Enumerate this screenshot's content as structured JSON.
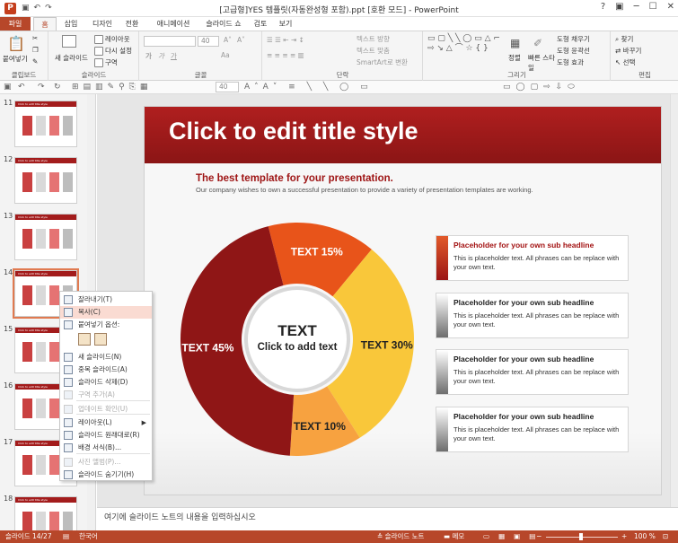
{
  "window": {
    "title": "[고급형]YES 템플릿(자동완성형 포함).ppt [호환 모드] - PowerPoint",
    "app_icon": "P",
    "controls": [
      "?",
      "▣",
      "─",
      "☐",
      "✕"
    ]
  },
  "tabs": [
    "파일",
    "홈",
    "삽입",
    "디자인",
    "전환",
    "애니메이션",
    "슬라이드 쇼",
    "검토",
    "보기"
  ],
  "ribbon": {
    "clipboard": {
      "paste": "붙여넣기",
      "label": "클립보드"
    },
    "slides": {
      "new_slide": "새 슬라이드",
      "layout": "레이아웃",
      "reset": "다시 설정",
      "section": "구역",
      "label": "슬라이드"
    },
    "font": {
      "size": "40",
      "label": "글꼴",
      "aa": "Aa"
    },
    "paragraph": {
      "text_direction": "텍스트 방향",
      "align_text": "텍스트 맞춤",
      "smartart": "SmartArt로 변환",
      "label": "단락"
    },
    "drawing": {
      "arrange": "정렬",
      "quick_styles": "빠른 스타일",
      "fill": "도형 채우기",
      "outline": "도형 윤곽선",
      "effects": "도형 효과",
      "label": "그리기"
    },
    "editing": {
      "find": "찾기",
      "replace": "바꾸기",
      "select": "선택",
      "label": "편집"
    }
  },
  "toolbar2": {
    "zoom_value": "40"
  },
  "thumbnails": {
    "items": [
      {
        "num": "11",
        "title": "Click to edit title style"
      },
      {
        "num": "12",
        "title": "Click to edit title style"
      },
      {
        "num": "13",
        "title": "Click to edit title style"
      },
      {
        "num": "14",
        "title": "Click to edit title style"
      },
      {
        "num": "15",
        "title": "Click to edit title style"
      },
      {
        "num": "16",
        "title": "Click to edit title style"
      },
      {
        "num": "17",
        "title": "Click to edit title style"
      },
      {
        "num": "18",
        "title": "Click to edit title style"
      }
    ],
    "selected": "14"
  },
  "context_menu": {
    "items": [
      {
        "label": "잘라내기(T)",
        "icon": "scissors-icon",
        "state": "normal"
      },
      {
        "label": "복사(C)",
        "icon": "copy-icon",
        "state": "highlighted"
      },
      {
        "label": "붙여넣기 옵션:",
        "icon": "paste-icon",
        "state": "normal"
      },
      {
        "label": "새 슬라이드(N)",
        "icon": "new-slide-icon",
        "state": "normal"
      },
      {
        "label": "중복 슬라이드(A)",
        "icon": "duplicate-icon",
        "state": "normal"
      },
      {
        "label": "슬라이드 삭제(D)",
        "icon": "delete-slide-icon",
        "state": "normal"
      },
      {
        "label": "구역 추가(A)",
        "icon": "section-icon",
        "state": "disabled"
      },
      {
        "label": "업데이트 확인(U)",
        "icon": "update-icon",
        "state": "disabled"
      },
      {
        "label": "레이아웃(L)",
        "icon": "layout-icon",
        "state": "normal"
      },
      {
        "label": "슬라이드 원래대로(R)",
        "icon": "reset-icon",
        "state": "normal"
      },
      {
        "label": "배경 서식(B)...",
        "icon": "background-icon",
        "state": "normal"
      },
      {
        "label": "사진 앨범(P)...",
        "icon": "photo-album-icon",
        "state": "disabled"
      },
      {
        "label": "슬라이드 숨기기(H)",
        "icon": "hide-slide-icon",
        "state": "normal"
      }
    ]
  },
  "slide": {
    "title": "Click to edit title style",
    "subtitle": "The best template for your presentation.",
    "description": "Our company wishes to own a successful presentation to provide a variety of presentation templates are working.",
    "center_title": "TEXT",
    "center_sub": "Click to add text",
    "placeholders": [
      {
        "title": "Placeholder  for your own sub headline",
        "body": "This is placeholder text. All phrases can be replace with your own text.",
        "accent": "red"
      },
      {
        "title": "Placeholder  for your own sub headline",
        "body": "This is placeholder text. All phrases can be replace with your own text.",
        "accent": "gray"
      },
      {
        "title": "Placeholder  for your own sub headline",
        "body": "This is placeholder text. All phrases can be replace with your own text.",
        "accent": "gray"
      },
      {
        "title": "Placeholder  for your own sub headline",
        "body": "This is placeholder text. All phrases can be replace with your own text.",
        "accent": "gray"
      }
    ]
  },
  "chart_data": {
    "type": "pie",
    "categories": [
      "TEXT 15%",
      "TEXT 30%",
      "TEXT 10%",
      "TEXT 45%"
    ],
    "values": [
      15,
      30,
      10,
      45
    ],
    "colors": [
      "#e8541a",
      "#f9c73a",
      "#f7a240",
      "#8f1616"
    ]
  },
  "notes": {
    "placeholder": "여기에 슬라이드 노트의 내용을 입력하십시오"
  },
  "status": {
    "slide_info": "슬라이드 14/27",
    "language": "한국어",
    "notes_btn": "슬라이드 노트",
    "comments_btn": "메모",
    "zoom": "100 %"
  }
}
